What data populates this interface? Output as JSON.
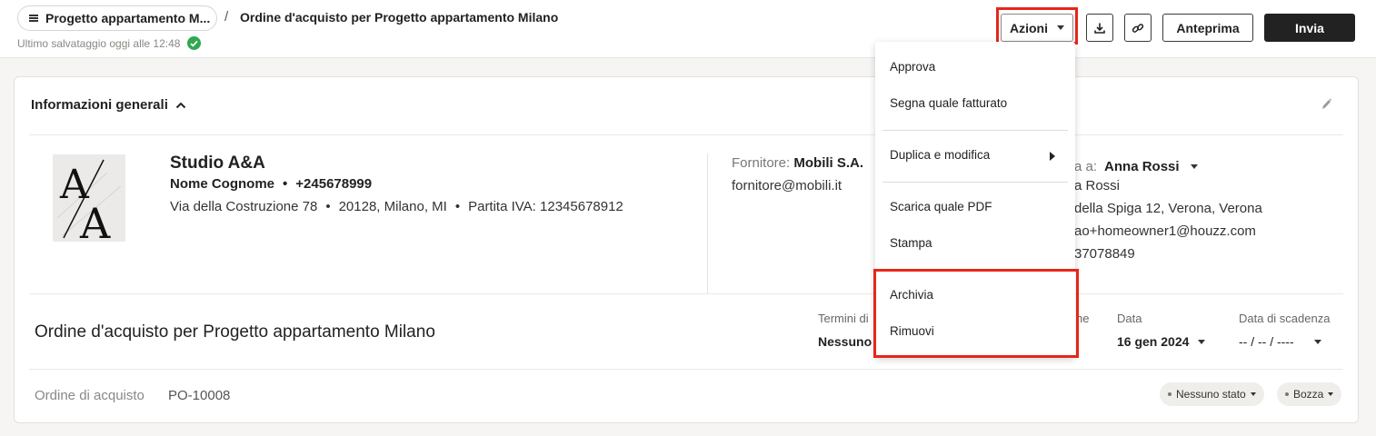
{
  "header": {
    "project_label": "Progetto appartamento M...",
    "breadcrumb_separator": "/",
    "page_title": "Ordine d'acquisto per Progetto appartamento Milano",
    "save_status": "Ultimo salvataggio oggi alle 12:48",
    "actions_label": "Azioni",
    "preview_label": "Anteprima",
    "send_label": "Invia"
  },
  "general_info": {
    "section_title": "Informazioni generali"
  },
  "company": {
    "name": "Studio A&A",
    "contact_name": "Nome Cognome",
    "phone": "+245678999",
    "address": "Via della Costruzione 78",
    "city": "20128, Milano, MI",
    "vat": "Partita IVA: 12345678912",
    "logo_text_top": "A",
    "logo_text_bottom": "A"
  },
  "supplier": {
    "label": "Fornitore:",
    "name": "Mobili S.A.",
    "email": "fornitore@mobili.it"
  },
  "client": {
    "label_partial": "a a:",
    "name": "Anna Rossi",
    "line1": "a Rossi",
    "line2": "della Spiga 12, Verona, Verona",
    "line3": "ao+homeowner1@houzz.com",
    "line4": "37078849"
  },
  "order": {
    "title": "Ordine d'acquisto per Progetto appartamento Milano",
    "terms_label_partial": "Termini di",
    "terms_value_partial": "Nessuno",
    "hidden_label_partial": "ne",
    "date_label": "Data",
    "date_value": "16 gen 2024",
    "due_label": "Data di scadenza",
    "due_value": "-- / -- / ----",
    "number_label": "Ordine di acquisto",
    "number_value": "PO-10008",
    "status_chip": "Nessuno stato",
    "draft_chip": "Bozza"
  },
  "actions_menu": {
    "items": [
      {
        "label": "Approva"
      },
      {
        "label": "Segna quale fatturato"
      },
      {
        "label": "Duplica e modifica"
      },
      {
        "label": "Scarica quale PDF"
      },
      {
        "label": "Stampa"
      },
      {
        "label": "Archivia"
      },
      {
        "label": "Rimuovi"
      }
    ]
  },
  "colors": {
    "highlight": "#e5261b",
    "success": "#2fa84f",
    "primary_button": "#222222"
  },
  "icons": {
    "download": "download-icon",
    "link": "link-icon",
    "edit": "pencil-icon",
    "menu": "hamburger-icon"
  }
}
